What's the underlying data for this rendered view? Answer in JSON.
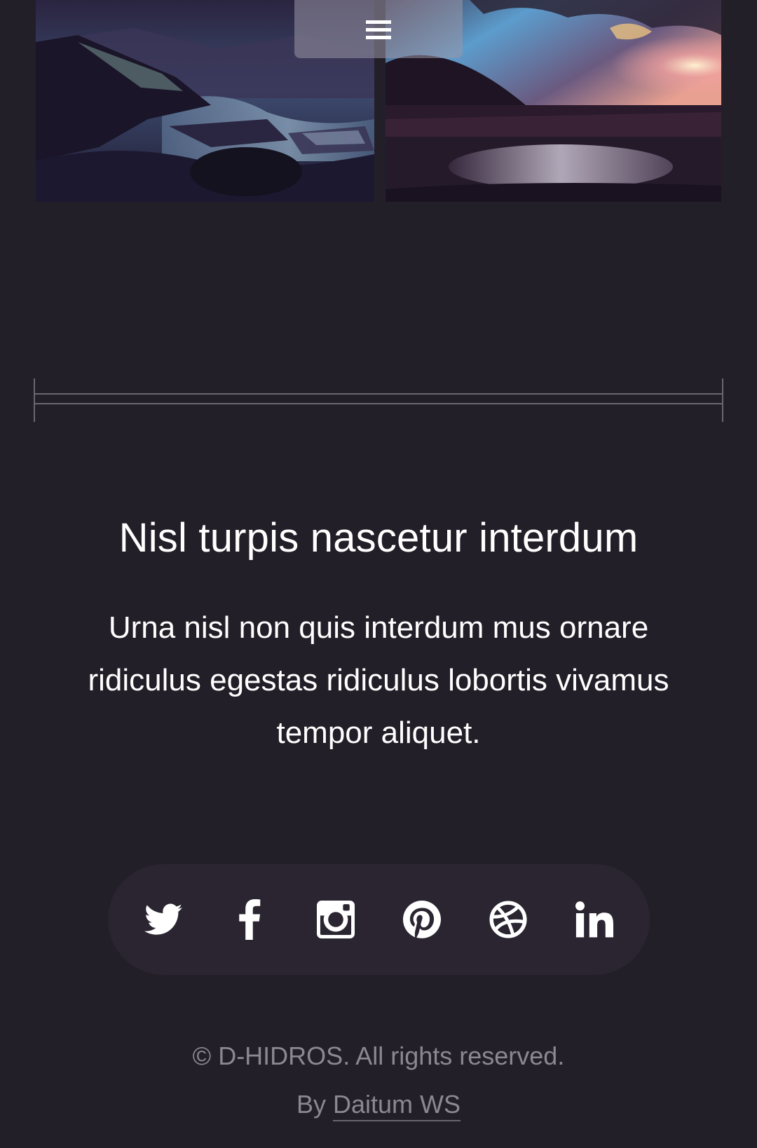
{
  "menu": {
    "icon": "hamburger-icon"
  },
  "gallery": {
    "images": [
      {
        "name": "rocky-shore-image"
      },
      {
        "name": "lake-sunset-image"
      }
    ]
  },
  "section": {
    "heading": "Nisl turpis nascetur interdum",
    "body": "Urna nisl non quis interdum mus ornare ridiculus egestas ridiculus lobortis vivamus tempor aliquet."
  },
  "social": {
    "links": [
      {
        "icon": "twitter-icon"
      },
      {
        "icon": "facebook-icon"
      },
      {
        "icon": "instagram-icon"
      },
      {
        "icon": "pinterest-icon"
      },
      {
        "icon": "dribbble-icon"
      },
      {
        "icon": "linkedin-icon"
      }
    ]
  },
  "footer": {
    "copyright": "© D-HIDROS. All rights reserved.",
    "credit_prefix": "By ",
    "credit_link": "Daitum WS"
  },
  "colors": {
    "background": "#231f28",
    "social_bar": "#2a2530",
    "muted_text": "#8c8892",
    "heading_text": "#ffffff"
  }
}
